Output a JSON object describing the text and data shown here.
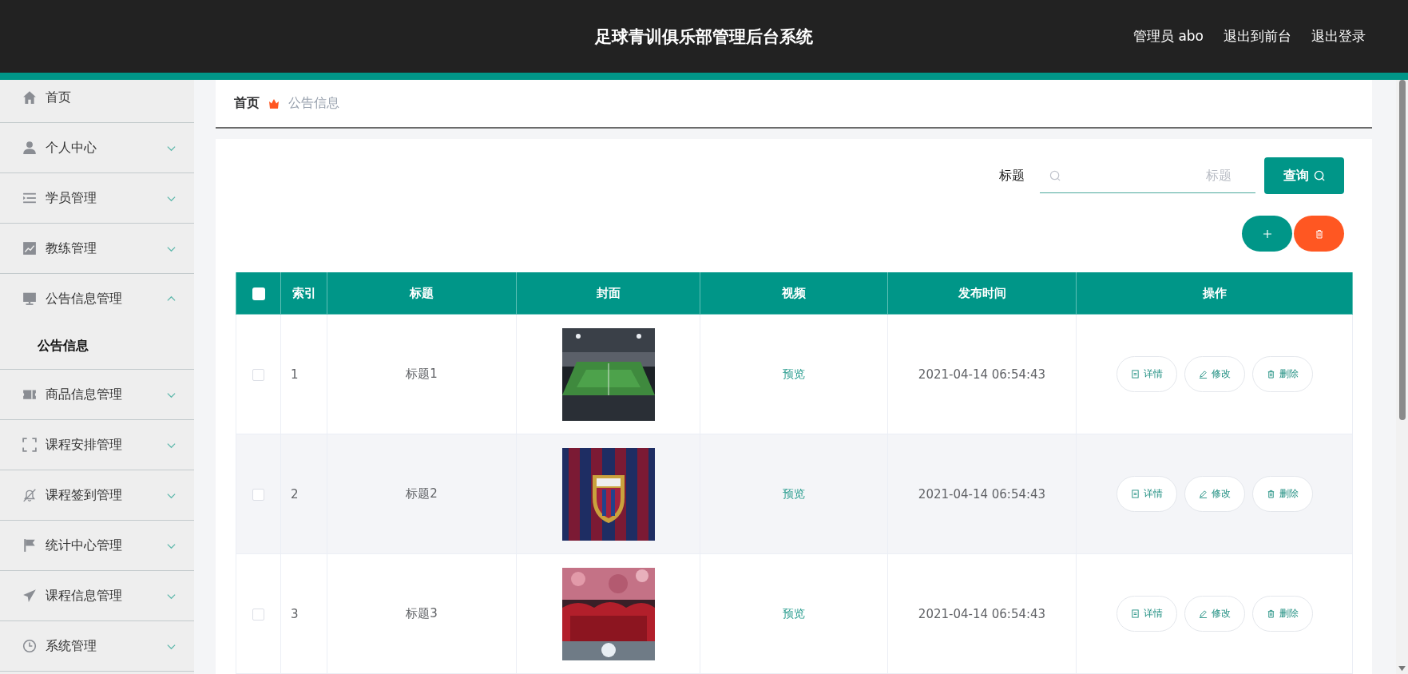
{
  "header": {
    "title": "足球青训俱乐部管理后台系统",
    "user": "管理员 abo",
    "links": [
      "退出到前台",
      "退出登录"
    ]
  },
  "sidebar": {
    "items": [
      {
        "label": "首页"
      },
      {
        "label": "个人中心",
        "expanded": false
      },
      {
        "label": "学员管理",
        "expanded": false
      },
      {
        "label": "教练管理",
        "expanded": false
      },
      {
        "label": "公告信息管理",
        "expanded": true,
        "children": [
          {
            "label": "公告信息",
            "selected": true
          }
        ]
      },
      {
        "label": "商品信息管理",
        "expanded": false
      },
      {
        "label": "课程安排管理",
        "expanded": false
      },
      {
        "label": "课程签到管理",
        "expanded": false
      },
      {
        "label": "统计中心管理",
        "expanded": false
      },
      {
        "label": "课程信息管理",
        "expanded": false
      },
      {
        "label": "系统管理",
        "expanded": false
      }
    ]
  },
  "breadcrumb": [
    "首页",
    "公告信息"
  ],
  "search": {
    "label": "标题",
    "placeholder": "标题",
    "button": "查询"
  },
  "table": {
    "select_all": {
      "checked": false
    },
    "columns": [
      "索引",
      "标题",
      "封面",
      "视频",
      "发布时间",
      "操作"
    ],
    "rows": [
      {
        "checked": false,
        "index": "1",
        "title": "标题1",
        "video": "预览",
        "time": "2021-04-14 06:54:43",
        "actions": [
          "详情",
          "修改",
          "删除"
        ]
      },
      {
        "checked": false,
        "index": "2",
        "title": "标题2",
        "video": "预览",
        "time": "2021-04-14 06:54:43",
        "actions": [
          "详情",
          "修改",
          "删除"
        ]
      },
      {
        "checked": false,
        "index": "3",
        "title": "标题3",
        "video": "预览",
        "time": "2021-04-14 06:54:43",
        "actions": [
          "详情",
          "修改",
          "删除"
        ]
      }
    ]
  }
}
